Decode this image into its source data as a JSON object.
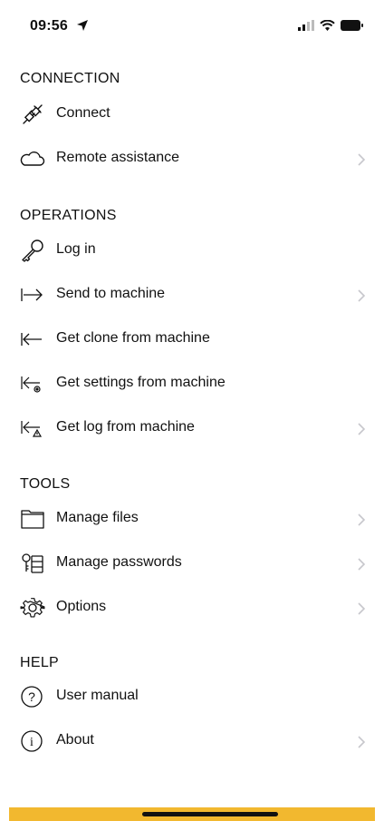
{
  "status": {
    "time": "09:56"
  },
  "sections": {
    "connection": "CONNECTION",
    "operations": "OPERATIONS",
    "tools": "TOOLS",
    "help": "HELP"
  },
  "items": {
    "connect": "Connect",
    "remote_assistance": "Remote assistance",
    "log_in": "Log in",
    "send_to_machine": "Send to machine",
    "get_clone": "Get clone from machine",
    "get_settings": "Get settings from machine",
    "get_log": "Get log from machine",
    "manage_files": "Manage files",
    "manage_passwords": "Manage passwords",
    "options": "Options",
    "user_manual": "User manual",
    "about": "About"
  },
  "colors": {
    "accent_bar": "#f2b82f",
    "chevron": "#c7c7cc"
  }
}
